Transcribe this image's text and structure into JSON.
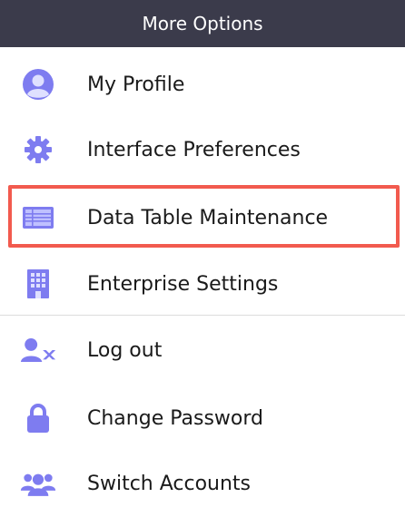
{
  "header": {
    "title": "More Options"
  },
  "items": [
    {
      "label": "My Profile",
      "icon": "user-circle-icon"
    },
    {
      "label": "Interface Preferences",
      "icon": "gear-icon"
    },
    {
      "label": "Data Table Maintenance",
      "icon": "data-table-icon"
    },
    {
      "label": "Enterprise Settings",
      "icon": "building-icon"
    },
    {
      "label": "Log out",
      "icon": "user-remove-icon"
    },
    {
      "label": "Change Password",
      "icon": "lock-icon"
    },
    {
      "label": "Switch Accounts",
      "icon": "users-group-icon"
    }
  ],
  "colors": {
    "header_bg": "#3b3b4b",
    "icon": "#7e7cf0",
    "highlight_border": "#f25a4e",
    "divider": "#dcdcdc"
  }
}
